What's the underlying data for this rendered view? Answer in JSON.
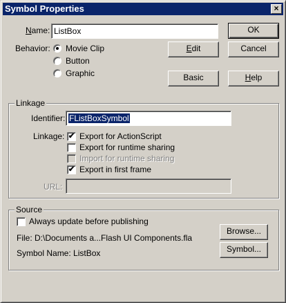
{
  "window": {
    "title": "Symbol Properties",
    "close_glyph": "×"
  },
  "general": {
    "name_label": "Name:",
    "name_value": "ListBox",
    "behavior_label": "Behavior:",
    "behavior_options": [
      "Movie Clip",
      "Button",
      "Graphic"
    ],
    "behavior_selected": "Movie Clip"
  },
  "buttons": {
    "ok": "OK",
    "cancel": "Cancel",
    "edit": "Edit",
    "basic": "Basic",
    "help": "Help"
  },
  "linkage": {
    "group_title": "Linkage",
    "identifier_label": "Identifier:",
    "identifier_value": "FListBoxSymbol",
    "linkage_label": "Linkage:",
    "options": [
      {
        "label": "Export for ActionScript",
        "checked": true,
        "enabled": true
      },
      {
        "label": "Export for runtime sharing",
        "checked": false,
        "enabled": true
      },
      {
        "label": "Import for runtime sharing",
        "checked": false,
        "enabled": false
      },
      {
        "label": "Export in first frame",
        "checked": true,
        "enabled": true
      }
    ],
    "url_label": "URL:",
    "url_value": ""
  },
  "source": {
    "group_title": "Source",
    "always_update_label": "Always update before publishing",
    "always_update_checked": false,
    "file_text": "File: D:\\Documents a...Flash UI Components.fla",
    "symbol_name_text": "Symbol Name:  ListBox",
    "browse_button": "Browse...",
    "symbol_button": "Symbol..."
  },
  "icons": {
    "radio_checked": "radio-selected-dot",
    "checkmark": "✔"
  }
}
